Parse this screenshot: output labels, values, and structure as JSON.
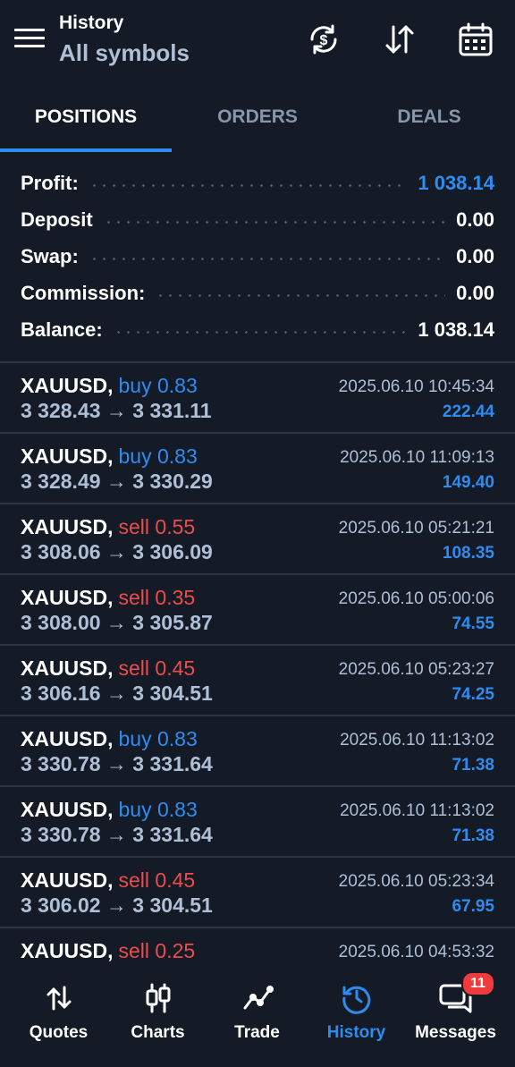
{
  "header": {
    "title": "History",
    "subtitle": "All symbols",
    "icons": [
      "menu-icon",
      "sync-icon",
      "sort-icon",
      "calendar-icon"
    ]
  },
  "tabs": [
    {
      "label": "POSITIONS",
      "active": true
    },
    {
      "label": "ORDERS",
      "active": false
    },
    {
      "label": "DEALS",
      "active": false
    }
  ],
  "summary": {
    "profit": {
      "label": "Profit:",
      "value": "1 038.14"
    },
    "deposit": {
      "label": "Deposit",
      "value": "0.00"
    },
    "swap": {
      "label": "Swap:",
      "value": "0.00"
    },
    "commission": {
      "label": "Commission:",
      "value": "0.00"
    },
    "balance": {
      "label": "Balance:",
      "value": "1 038.14"
    }
  },
  "deals": [
    {
      "symbol": "XAUUSD,",
      "side": "buy 0.83",
      "type": "buy",
      "prices": "3 328.43 → 3 331.11",
      "time": "2025.06.10 10:45:34",
      "profit": "222.44"
    },
    {
      "symbol": "XAUUSD,",
      "side": "buy 0.83",
      "type": "buy",
      "prices": "3 328.49 → 3 330.29",
      "time": "2025.06.10 11:09:13",
      "profit": "149.40"
    },
    {
      "symbol": "XAUUSD,",
      "side": "sell 0.55",
      "type": "sell",
      "prices": "3 308.06 → 3 306.09",
      "time": "2025.06.10 05:21:21",
      "profit": "108.35"
    },
    {
      "symbol": "XAUUSD,",
      "side": "sell 0.35",
      "type": "sell",
      "prices": "3 308.00 → 3 305.87",
      "time": "2025.06.10 05:00:06",
      "profit": "74.55"
    },
    {
      "symbol": "XAUUSD,",
      "side": "sell 0.45",
      "type": "sell",
      "prices": "3 306.16 → 3 304.51",
      "time": "2025.06.10 05:23:27",
      "profit": "74.25"
    },
    {
      "symbol": "XAUUSD,",
      "side": "buy 0.83",
      "type": "buy",
      "prices": "3 330.78 → 3 331.64",
      "time": "2025.06.10 11:13:02",
      "profit": "71.38"
    },
    {
      "symbol": "XAUUSD,",
      "side": "buy 0.83",
      "type": "buy",
      "prices": "3 330.78 → 3 331.64",
      "time": "2025.06.10 11:13:02",
      "profit": "71.38"
    },
    {
      "symbol": "XAUUSD,",
      "side": "sell 0.45",
      "type": "sell",
      "prices": "3 306.02 → 3 304.51",
      "time": "2025.06.10 05:23:34",
      "profit": "67.95"
    },
    {
      "symbol": "XAUUSD,",
      "side": "sell 0.25",
      "type": "sell",
      "prices": "",
      "time": "2025.06.10 04:53:32",
      "profit": ""
    }
  ],
  "nav": {
    "quotes": {
      "label": "Quotes",
      "icon": "quotes-arrows-icon"
    },
    "charts": {
      "label": "Charts",
      "icon": "candlestick-icon"
    },
    "trade": {
      "label": "Trade",
      "icon": "trade-line-icon"
    },
    "history": {
      "label": "History",
      "icon": "history-clock-icon",
      "active": true
    },
    "messages": {
      "label": "Messages",
      "icon": "messages-icon",
      "badge": "11"
    }
  },
  "colors": {
    "background": "#141b27",
    "accent": "#2e8cf0",
    "sell": "#ee4b4b",
    "muted": "#aebfd6",
    "badge": "#ee3b3b"
  }
}
